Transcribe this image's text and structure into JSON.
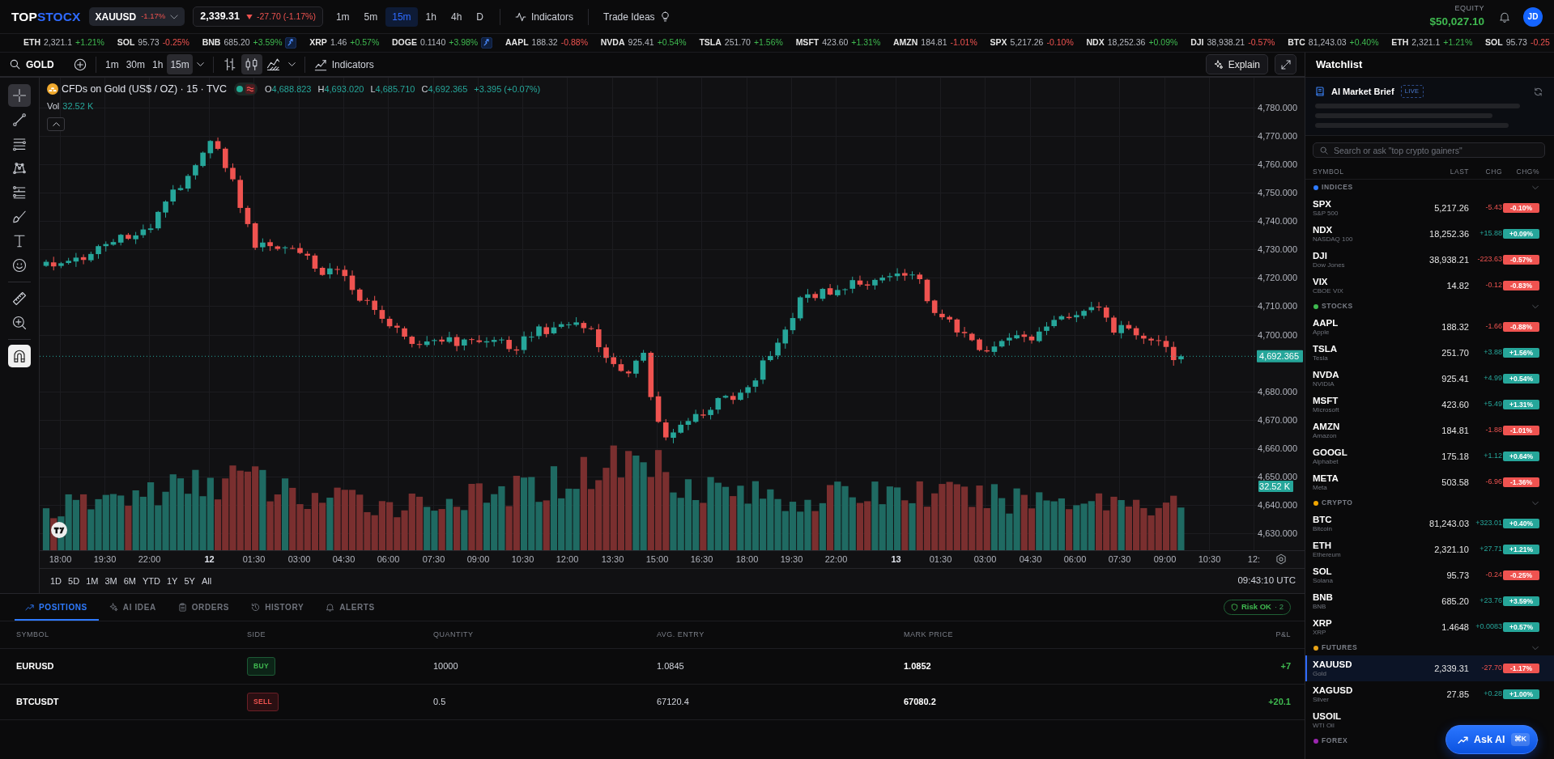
{
  "top_bar": {
    "logo": {
      "lead": "TOP",
      "accent": "STOCX"
    },
    "symbol_selector": {
      "symbol": "XAUUSD",
      "change_pct": "-1.17%",
      "gain": false
    },
    "quote": {
      "price": "2,339.31",
      "change": "-27.70 (-1.17%)",
      "gain": false
    },
    "timeframes": [
      {
        "label": "1m",
        "selected": false
      },
      {
        "label": "5m",
        "selected": false
      },
      {
        "label": "15m",
        "selected": true
      },
      {
        "label": "1h",
        "selected": false
      },
      {
        "label": "4h",
        "selected": false
      },
      {
        "label": "D",
        "selected": false
      }
    ],
    "indicators_button": "Indicators",
    "trade_ideas_button": "Trade Ideas",
    "equity": {
      "label": "EQUITY",
      "value": "$50,027.10"
    },
    "avatar_initials": "JD"
  },
  "ticker": [
    {
      "symbol": "ETH",
      "price": "2,321.1",
      "change": "+1.21%",
      "gain": true,
      "signal": false
    },
    {
      "symbol": "SOL",
      "price": "95.73",
      "change": "-0.25%",
      "gain": false,
      "signal": false
    },
    {
      "symbol": "BNB",
      "price": "685.20",
      "change": "+3.59%",
      "gain": true,
      "signal": true
    },
    {
      "symbol": "XRP",
      "price": "1.46",
      "change": "+0.57%",
      "gain": true,
      "signal": false
    },
    {
      "symbol": "DOGE",
      "price": "0.1140",
      "change": "+3.98%",
      "gain": true,
      "signal": true
    },
    {
      "symbol": "AAPL",
      "price": "188.32",
      "change": "-0.88%",
      "gain": false,
      "signal": false
    },
    {
      "symbol": "NVDA",
      "price": "925.41",
      "change": "+0.54%",
      "gain": true,
      "signal": false
    },
    {
      "symbol": "TSLA",
      "price": "251.70",
      "change": "+1.56%",
      "gain": true,
      "signal": false
    },
    {
      "symbol": "MSFT",
      "price": "423.60",
      "change": "+1.31%",
      "gain": true,
      "signal": false
    },
    {
      "symbol": "AMZN",
      "price": "184.81",
      "change": "-1.01%",
      "gain": false,
      "signal": false
    },
    {
      "symbol": "SPX",
      "price": "5,217.26",
      "change": "-0.10%",
      "gain": false,
      "signal": false
    },
    {
      "symbol": "NDX",
      "price": "18,252.36",
      "change": "+0.09%",
      "gain": true,
      "signal": false
    },
    {
      "symbol": "DJI",
      "price": "38,938.21",
      "change": "-0.57%",
      "gain": false,
      "signal": false
    },
    {
      "symbol": "BTC",
      "price": "81,243.03",
      "change": "+0.40%",
      "gain": true,
      "signal": false
    },
    {
      "symbol": "ETH",
      "price": "2,321.1",
      "change": "+1.21%",
      "gain": true,
      "signal": false
    },
    {
      "symbol": "SOL",
      "price": "95.73",
      "change": "-0.25",
      "gain": false,
      "signal": false
    }
  ],
  "chart_toolbar": {
    "symbol": "GOLD",
    "intervals": [
      {
        "label": "1m",
        "selected": false
      },
      {
        "label": "30m",
        "selected": false
      },
      {
        "label": "1h",
        "selected": false
      },
      {
        "label": "15m",
        "selected": true
      }
    ],
    "chart_types": [
      {
        "kind": "bars",
        "selected": false
      },
      {
        "kind": "candles",
        "selected": true
      },
      {
        "kind": "area",
        "selected": false
      }
    ],
    "indicators_button": "Indicators",
    "explain_button": "Explain"
  },
  "drawing_tools": [
    {
      "tools": [
        {
          "kind": "crosshair",
          "selected": true
        },
        {
          "kind": "trend-line",
          "selected": false
        },
        {
          "kind": "fib-lines",
          "selected": false
        },
        {
          "kind": "pattern",
          "selected": false
        },
        {
          "kind": "long-short",
          "selected": false
        },
        {
          "kind": "brush",
          "selected": false
        },
        {
          "kind": "text",
          "selected": false
        },
        {
          "kind": "emoji",
          "selected": false
        }
      ]
    },
    {
      "tools": [
        {
          "kind": "ruler",
          "selected": false
        },
        {
          "kind": "zoom",
          "selected": false
        }
      ]
    },
    {
      "tools": [
        {
          "kind": "magnet",
          "selected": true
        }
      ]
    }
  ],
  "chart": {
    "title": "CFDs on Gold (US$ / OZ) · 15 · TVC",
    "ohlc": [
      {
        "label": "O",
        "value": "4,688.823"
      },
      {
        "label": "H",
        "value": "4,693.020"
      },
      {
        "label": "L",
        "value": "4,685.710"
      },
      {
        "label": "C",
        "value": "4,692.365"
      }
    ],
    "change": "+3.395 (+0.07%)",
    "volume": {
      "label": "Vol",
      "value": "32.52 K"
    },
    "price_axis": [
      "4,780.000",
      "4,770.000",
      "4,760.000",
      "4,750.000",
      "4,740.000",
      "4,730.000",
      "4,720.000",
      "4,710.000",
      "4,700.000",
      "4,680.000",
      "4,670.000",
      "4,660.000",
      "4,650.000",
      "4,640.000",
      "4,630.000"
    ],
    "last_price": "4,692.365",
    "last_volume": "32.52 K",
    "time_axis": [
      {
        "label": "18:00",
        "kind": "time"
      },
      {
        "label": "19:30",
        "kind": "time"
      },
      {
        "label": "22:00",
        "kind": "time"
      },
      {
        "label": "12",
        "kind": "day"
      },
      {
        "label": "01:30",
        "kind": "time"
      },
      {
        "label": "03:00",
        "kind": "time"
      },
      {
        "label": "04:30",
        "kind": "time"
      },
      {
        "label": "06:00",
        "kind": "time"
      },
      {
        "label": "07:30",
        "kind": "time"
      },
      {
        "label": "09:00",
        "kind": "time"
      },
      {
        "label": "10:30",
        "kind": "time"
      },
      {
        "label": "12:00",
        "kind": "time"
      },
      {
        "label": "13:30",
        "kind": "time"
      },
      {
        "label": "15:00",
        "kind": "time"
      },
      {
        "label": "16:30",
        "kind": "time"
      },
      {
        "label": "18:00",
        "kind": "time"
      },
      {
        "label": "19:30",
        "kind": "time"
      },
      {
        "label": "22:00",
        "kind": "time"
      },
      {
        "label": "13",
        "kind": "day"
      },
      {
        "label": "01:30",
        "kind": "time"
      },
      {
        "label": "03:00",
        "kind": "time"
      },
      {
        "label": "04:30",
        "kind": "time"
      },
      {
        "label": "06:00",
        "kind": "time"
      },
      {
        "label": "07:30",
        "kind": "time"
      },
      {
        "label": "09:00",
        "kind": "time"
      },
      {
        "label": "10:30",
        "kind": "time"
      },
      {
        "label": "12:",
        "kind": "time"
      }
    ],
    "ranges": [
      "1D",
      "5D",
      "1M",
      "3M",
      "6M",
      "YTD",
      "1Y",
      "5Y",
      "All"
    ],
    "clock": "09:43:10 UTC"
  },
  "bottom_panel": {
    "tabs": [
      {
        "label": "POSITIONS",
        "kind": "positions",
        "selected": true
      },
      {
        "label": "AI IDEA",
        "kind": "ai_idea",
        "selected": false
      },
      {
        "label": "ORDERS",
        "kind": "orders",
        "selected": false
      },
      {
        "label": "HISTORY",
        "kind": "history",
        "selected": false
      },
      {
        "label": "ALERTS",
        "kind": "alerts",
        "selected": false
      }
    ],
    "risk": {
      "label": "Risk OK",
      "count": "· 2"
    },
    "columns": [
      "SYMBOL",
      "SIDE",
      "QUANTITY",
      "AVG. ENTRY",
      "MARK PRICE",
      "P&L"
    ],
    "rows": [
      {
        "symbol": "EURUSD",
        "side": "BUY",
        "kind": "buy",
        "quantity": "10000",
        "avg_entry": "1.0845",
        "mark_price": "1.0852",
        "pnl": "+7",
        "pnl_gain": true
      },
      {
        "symbol": "BTCUSDT",
        "side": "SELL",
        "kind": "sell",
        "quantity": "0.5",
        "avg_entry": "67120.4",
        "mark_price": "67080.2",
        "pnl": "+20.1",
        "pnl_gain": true
      }
    ]
  },
  "watchlist": {
    "title": "Watchlist",
    "brief": {
      "title": "AI Market Brief",
      "badge": "LIVE",
      "loading": true
    },
    "search": {
      "placeholder": "Search or ask \"top crypto gainers\""
    },
    "columns": [
      "SYMBOL",
      "LAST",
      "CHG",
      "CHG%"
    ],
    "groups": [
      {
        "name": "INDICES",
        "color": "#2f7bff",
        "expanded": true,
        "items": [
          {
            "symbol": "SPX",
            "name": "S&P 500",
            "last": "5,217.26",
            "change": "-5.43",
            "change_pct": "-0.10%",
            "gain": false,
            "selected": false
          },
          {
            "symbol": "NDX",
            "name": "NASDAQ 100",
            "last": "18,252.36",
            "change": "+15.88",
            "change_pct": "+0.09%",
            "gain": true,
            "selected": false
          },
          {
            "symbol": "DJI",
            "name": "Dow Jones",
            "last": "38,938.21",
            "change": "-223.63",
            "change_pct": "-0.57%",
            "gain": false,
            "selected": false
          },
          {
            "symbol": "VIX",
            "name": "CBOE VIX",
            "last": "14.82",
            "change": "-0.12",
            "change_pct": "-0.83%",
            "gain": false,
            "selected": false
          }
        ]
      },
      {
        "name": "STOCKS",
        "color": "#3fb950",
        "expanded": true,
        "items": [
          {
            "symbol": "AAPL",
            "name": "Apple",
            "last": "188.32",
            "change": "-1.66",
            "change_pct": "-0.88%",
            "gain": false,
            "selected": false
          },
          {
            "symbol": "TSLA",
            "name": "Tesla",
            "last": "251.70",
            "change": "+3.88",
            "change_pct": "+1.56%",
            "gain": true,
            "selected": false
          },
          {
            "symbol": "NVDA",
            "name": "NVIDIA",
            "last": "925.41",
            "change": "+4.99",
            "change_pct": "+0.54%",
            "gain": true,
            "selected": false
          },
          {
            "symbol": "MSFT",
            "name": "Microsoft",
            "last": "423.60",
            "change": "+5.49",
            "change_pct": "+1.31%",
            "gain": true,
            "selected": false
          },
          {
            "symbol": "AMZN",
            "name": "Amazon",
            "last": "184.81",
            "change": "-1.88",
            "change_pct": "-1.01%",
            "gain": false,
            "selected": false
          },
          {
            "symbol": "GOOGL",
            "name": "Alphabet",
            "last": "175.18",
            "change": "+1.12",
            "change_pct": "+0.64%",
            "gain": true,
            "selected": false
          },
          {
            "symbol": "META",
            "name": "Meta",
            "last": "503.58",
            "change": "-6.96",
            "change_pct": "-1.36%",
            "gain": false,
            "selected": false
          }
        ]
      },
      {
        "name": "CRYPTO",
        "color": "#f0a500",
        "expanded": true,
        "items": [
          {
            "symbol": "BTC",
            "name": "Bitcoin",
            "last": "81,243.03",
            "change": "+323.01",
            "change_pct": "+0.40%",
            "gain": true,
            "selected": false
          },
          {
            "symbol": "ETH",
            "name": "Ethereum",
            "last": "2,321.10",
            "change": "+27.71",
            "change_pct": "+1.21%",
            "gain": true,
            "selected": false
          },
          {
            "symbol": "SOL",
            "name": "Solana",
            "last": "95.73",
            "change": "-0.24",
            "change_pct": "-0.25%",
            "gain": false,
            "selected": false
          },
          {
            "symbol": "BNB",
            "name": "BNB",
            "last": "685.20",
            "change": "+23.76",
            "change_pct": "+3.59%",
            "gain": true,
            "selected": false
          },
          {
            "symbol": "XRP",
            "name": "XRP",
            "last": "1.4648",
            "change": "+0.0083",
            "change_pct": "+0.57%",
            "gain": true,
            "selected": false
          }
        ]
      },
      {
        "name": "FUTURES",
        "color": "#e8a317",
        "expanded": true,
        "items": [
          {
            "symbol": "XAUUSD",
            "name": "Gold",
            "last": "2,339.31",
            "change": "-27.70",
            "change_pct": "-1.17%",
            "gain": false,
            "selected": true
          },
          {
            "symbol": "XAGUSD",
            "name": "Silver",
            "last": "27.85",
            "change": "+0.28",
            "change_pct": "+1.00%",
            "gain": true,
            "selected": false
          },
          {
            "symbol": "USOIL",
            "name": "WTI Oil",
            "selected": false
          }
        ]
      },
      {
        "name": "FOREX",
        "color": "#9c27b0",
        "expanded": true
      }
    ]
  },
  "ask_ai": {
    "label": "Ask AI",
    "shortcut": "⌘K"
  }
}
